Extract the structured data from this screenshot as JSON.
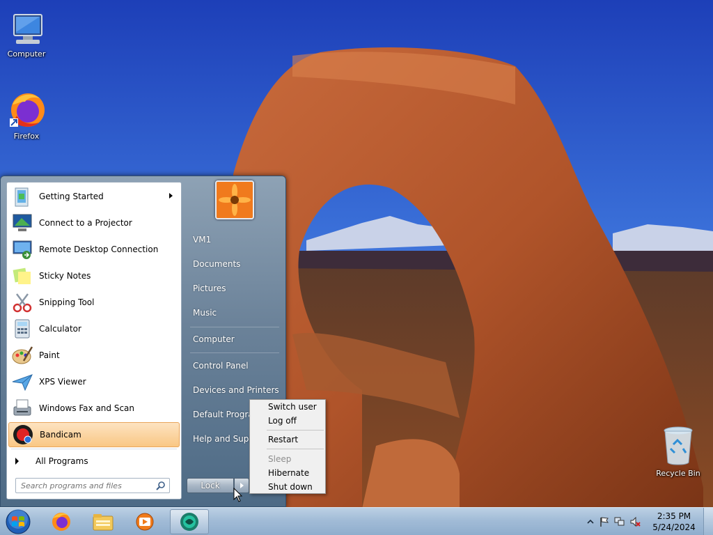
{
  "desktop": {
    "icons": [
      {
        "label": "Computer"
      },
      {
        "label": "Firefox"
      },
      {
        "label": "Recycle Bin"
      }
    ]
  },
  "start_menu": {
    "programs": [
      {
        "label": "Getting Started",
        "icon": "getting-started-icon",
        "has_submenu": true
      },
      {
        "label": "Connect to a Projector",
        "icon": "projector-icon"
      },
      {
        "label": "Remote Desktop Connection",
        "icon": "remote-desktop-icon"
      },
      {
        "label": "Sticky Notes",
        "icon": "sticky-notes-icon"
      },
      {
        "label": "Snipping Tool",
        "icon": "scissors-icon"
      },
      {
        "label": "Calculator",
        "icon": "calculator-icon"
      },
      {
        "label": "Paint",
        "icon": "paint-palette-icon"
      },
      {
        "label": "XPS Viewer",
        "icon": "xps-viewer-icon"
      },
      {
        "label": "Windows Fax and Scan",
        "icon": "fax-icon"
      },
      {
        "label": "Bandicam",
        "icon": "bandicam-icon",
        "selected": true
      }
    ],
    "all_programs_label": "All Programs",
    "search_placeholder": "Search programs and files",
    "places": [
      {
        "label": "VM1"
      },
      {
        "label": "Documents"
      },
      {
        "label": "Pictures"
      },
      {
        "label": "Music"
      },
      {
        "label": "Computer"
      },
      {
        "label": "Control Panel"
      },
      {
        "label": "Devices and Printers"
      },
      {
        "label": "Default Programs"
      },
      {
        "label": "Help and Support"
      }
    ],
    "lock_label": "Lock"
  },
  "shutdown_menu": {
    "items": [
      {
        "label": "Switch user",
        "enabled": true
      },
      {
        "label": "Log off",
        "enabled": true
      },
      {
        "label": "Restart",
        "enabled": true
      },
      {
        "label": "Sleep",
        "enabled": false
      },
      {
        "label": "Hibernate",
        "enabled": true
      },
      {
        "label": "Shut down",
        "enabled": true
      }
    ]
  },
  "taskbar": {
    "pinned": [
      {
        "icon": "firefox-icon"
      },
      {
        "icon": "file-explorer-icon"
      },
      {
        "icon": "media-player-icon"
      },
      {
        "icon": "bandicam-app-icon",
        "active": true
      }
    ],
    "clock": {
      "time": "2:35 PM",
      "date": "5/24/2024"
    }
  },
  "colors": {
    "accent_selected": "#f9c784",
    "start_menu_bg": "#6b8299",
    "taskbar_bg": "#a2bcd7"
  }
}
